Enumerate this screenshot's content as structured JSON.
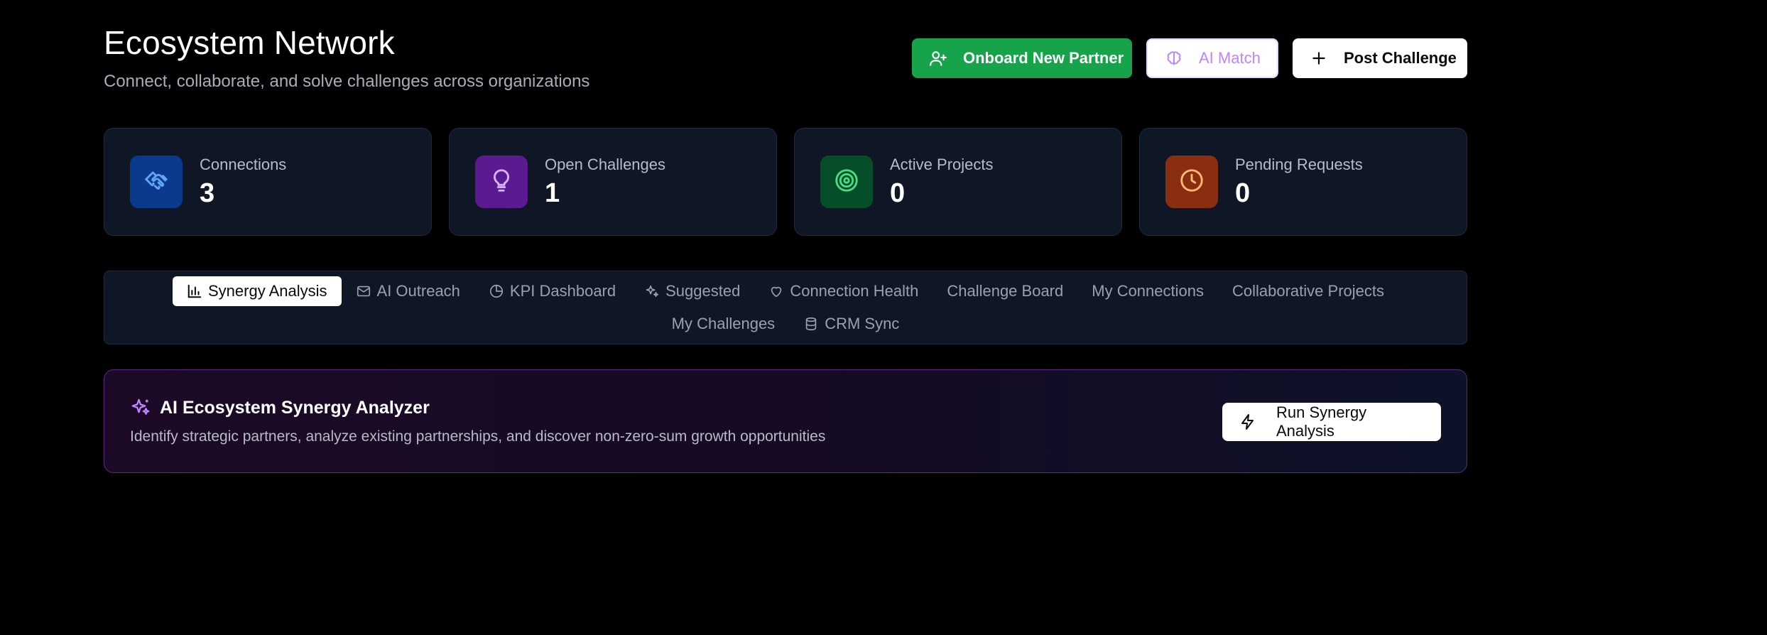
{
  "header": {
    "title": "Ecosystem Network",
    "subtitle": "Connect, collaborate, and solve challenges across organizations"
  },
  "actions": {
    "onboard_label": "Onboard New Partner",
    "ai_match_label": "AI Match",
    "post_challenge_label": "Post Challenge"
  },
  "stats": [
    {
      "label": "Connections",
      "value": "3",
      "icon": "handshake-icon",
      "bg": "#0b3a8c",
      "fg": "#60a5fa"
    },
    {
      "label": "Open Challenges",
      "value": "1",
      "icon": "lightbulb-icon",
      "bg": "#5b1a8f",
      "fg": "#d8b4fe"
    },
    {
      "label": "Active Projects",
      "value": "0",
      "icon": "target-icon",
      "bg": "#064e2a",
      "fg": "#4ade80"
    },
    {
      "label": "Pending Requests",
      "value": "0",
      "icon": "clock-icon",
      "bg": "#8a2e12",
      "fg": "#fdba74"
    }
  ],
  "tabs": [
    {
      "label": "Synergy Analysis",
      "icon": "bar-chart-icon",
      "active": true
    },
    {
      "label": "AI Outreach",
      "icon": "mail-icon"
    },
    {
      "label": "KPI Dashboard",
      "icon": "pie-chart-icon"
    },
    {
      "label": "Suggested",
      "icon": "sparkles-icon"
    },
    {
      "label": "Connection Health",
      "icon": "heart-icon"
    },
    {
      "label": "Challenge Board"
    },
    {
      "label": "My Connections"
    },
    {
      "label": "Collaborative Projects"
    },
    {
      "label": "My Challenges"
    },
    {
      "label": "CRM Sync",
      "icon": "database-icon"
    }
  ],
  "analyzer": {
    "title": "AI Ecosystem Synergy Analyzer",
    "description": "Identify strategic partners, analyze existing partnerships, and discover non-zero-sum growth opportunities",
    "run_label": "Run Synergy Analysis"
  },
  "colors": {
    "accent_green": "#16a34a",
    "ai_purple": "#c084fc",
    "card_bg": "#0f1727"
  }
}
